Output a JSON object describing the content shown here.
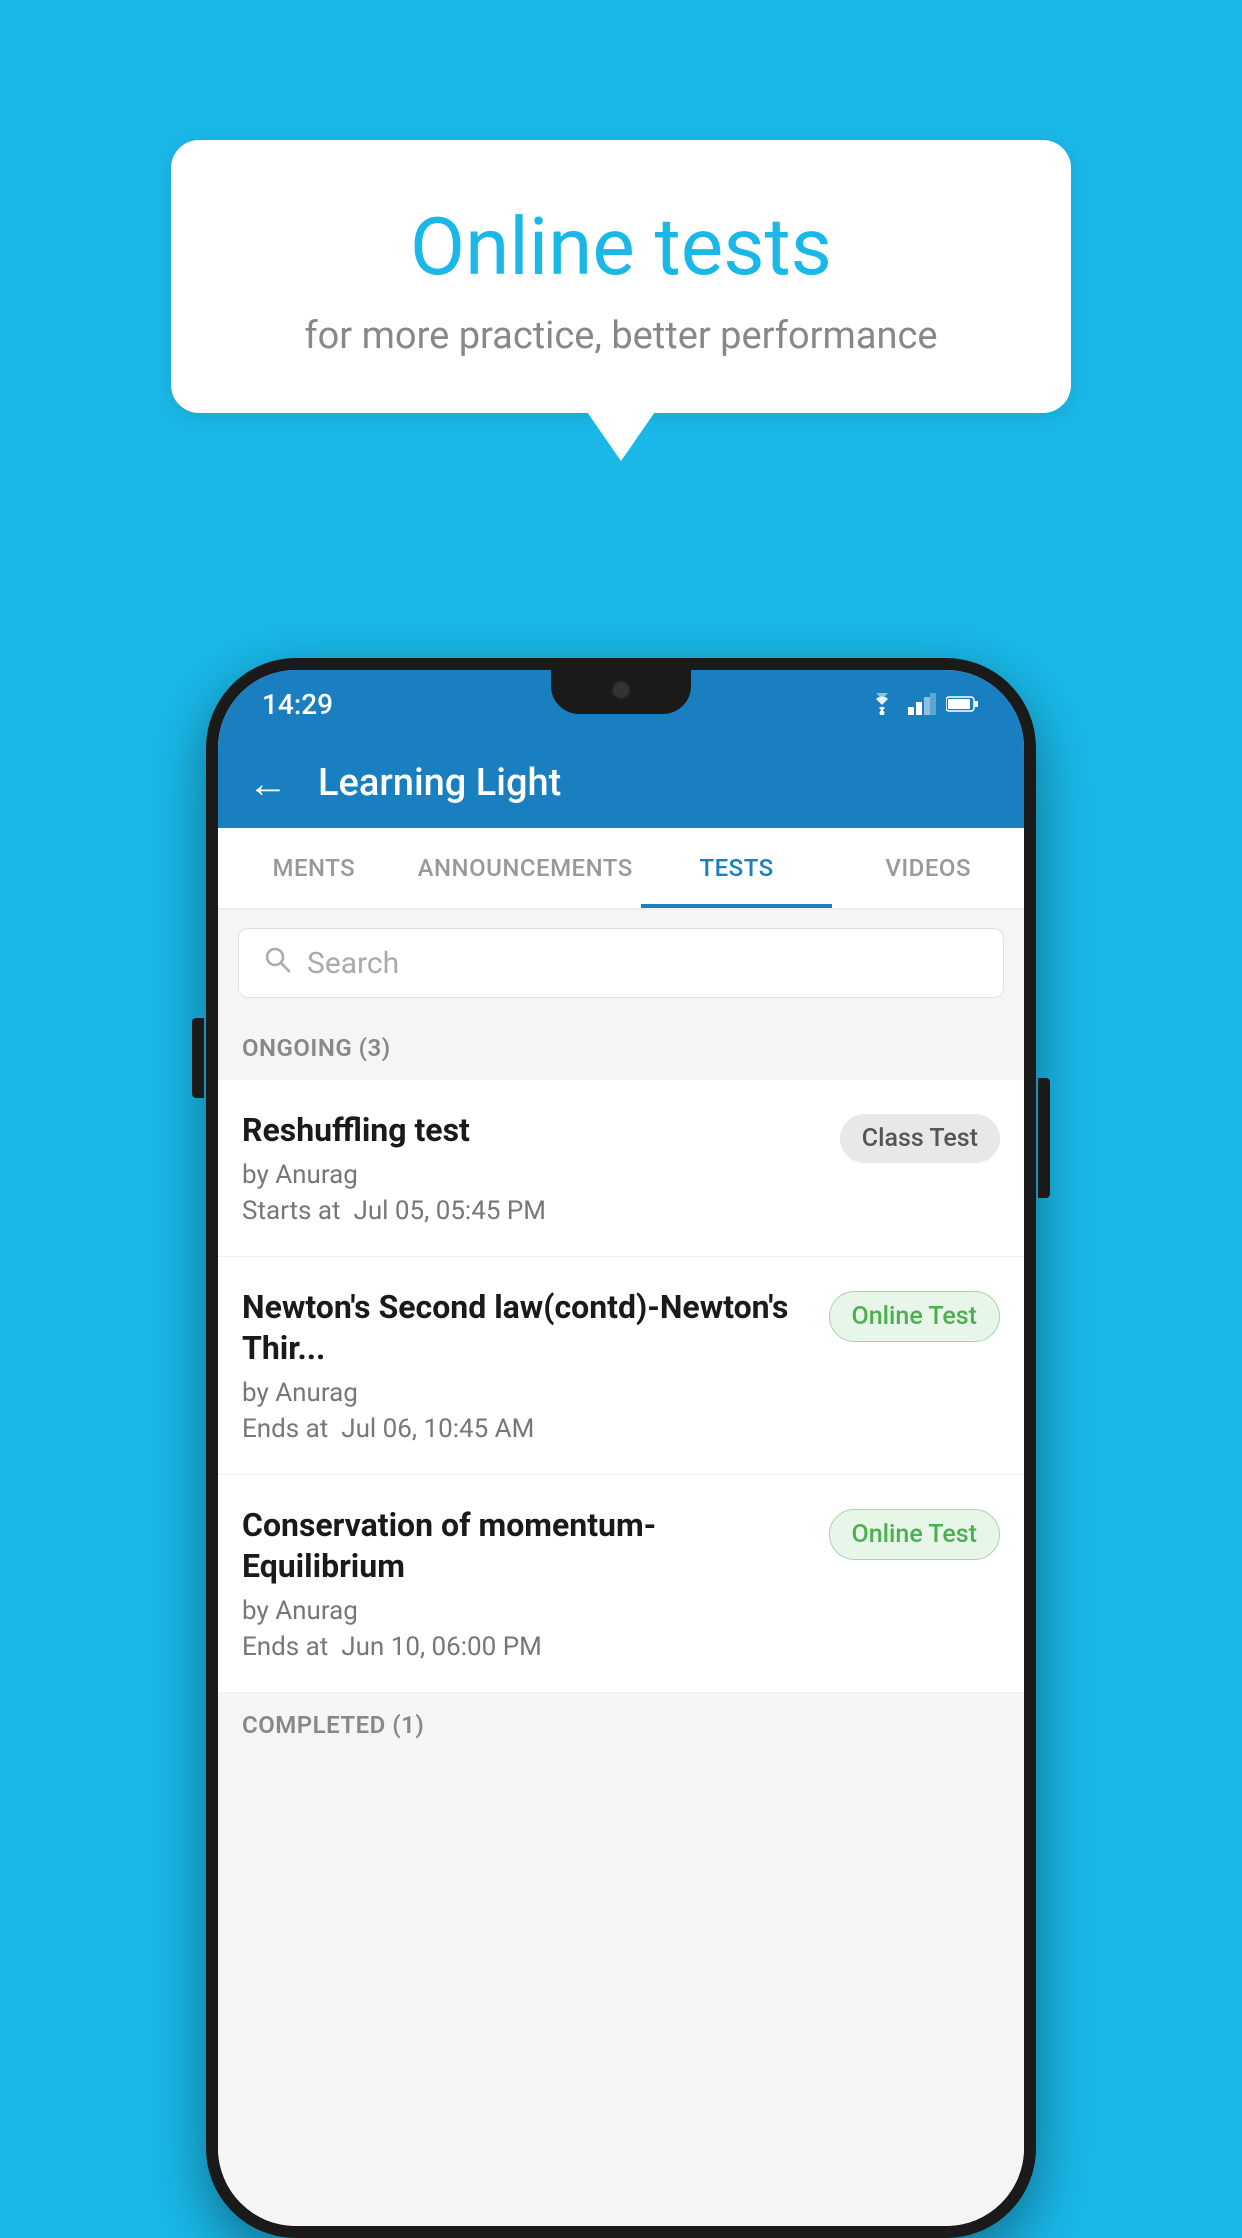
{
  "background_color": "#1ab8e8",
  "speech_bubble": {
    "title": "Online tests",
    "subtitle": "for more practice, better performance"
  },
  "status_bar": {
    "time": "14:29",
    "icons": [
      "wifi",
      "signal",
      "battery"
    ]
  },
  "app_header": {
    "title": "Learning Light",
    "back_label": "←"
  },
  "tabs": [
    {
      "label": "MENTS",
      "active": false
    },
    {
      "label": "ANNOUNCEMENTS",
      "active": false
    },
    {
      "label": "TESTS",
      "active": true
    },
    {
      "label": "VIDEOS",
      "active": false
    }
  ],
  "search": {
    "placeholder": "Search"
  },
  "sections": [
    {
      "header": "ONGOING (3)",
      "items": [
        {
          "title": "Reshuffling test",
          "author": "by Anurag",
          "time_label": "Starts at",
          "time": "Jul 05, 05:45 PM",
          "badge": "Class Test",
          "badge_type": "class"
        },
        {
          "title": "Newton's Second law(contd)-Newton's Thir...",
          "author": "by Anurag",
          "time_label": "Ends at",
          "time": "Jul 06, 10:45 AM",
          "badge": "Online Test",
          "badge_type": "online"
        },
        {
          "title": "Conservation of momentum-Equilibrium",
          "author": "by Anurag",
          "time_label": "Ends at",
          "time": "Jun 10, 06:00 PM",
          "badge": "Online Test",
          "badge_type": "online"
        }
      ]
    },
    {
      "header": "COMPLETED (1)",
      "items": []
    }
  ]
}
